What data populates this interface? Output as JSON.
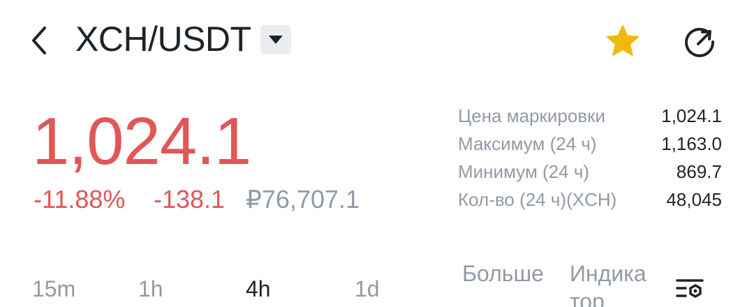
{
  "header": {
    "back_icon": "chevron-left-icon",
    "pair": "XCH/USDT",
    "dropdown_icon": "caret-down-icon",
    "favorite_icon": "star-icon",
    "favorite_color": "#f0b90b",
    "share_icon": "share-icon"
  },
  "price": {
    "last": "1,024.1",
    "change_percent": "-11.88%",
    "change_abs": "-138.1",
    "fiat": "₽76,707.1",
    "down_color": "#e05756"
  },
  "stats": [
    {
      "label": "Цена маркировки",
      "value": "1,024.1"
    },
    {
      "label": "Максимум (24 ч)",
      "value": "1,163.0"
    },
    {
      "label": "Минимум (24 ч)",
      "value": "869.7"
    },
    {
      "label": "Кол-во (24 ч)(XCH)",
      "value": "48,045"
    }
  ],
  "intervals": {
    "items": [
      "15m",
      "1h",
      "4h",
      "1d"
    ],
    "active": "4h",
    "more": "Больше",
    "indicator": "Индикатор",
    "settings_icon": "chart-settings-icon"
  }
}
